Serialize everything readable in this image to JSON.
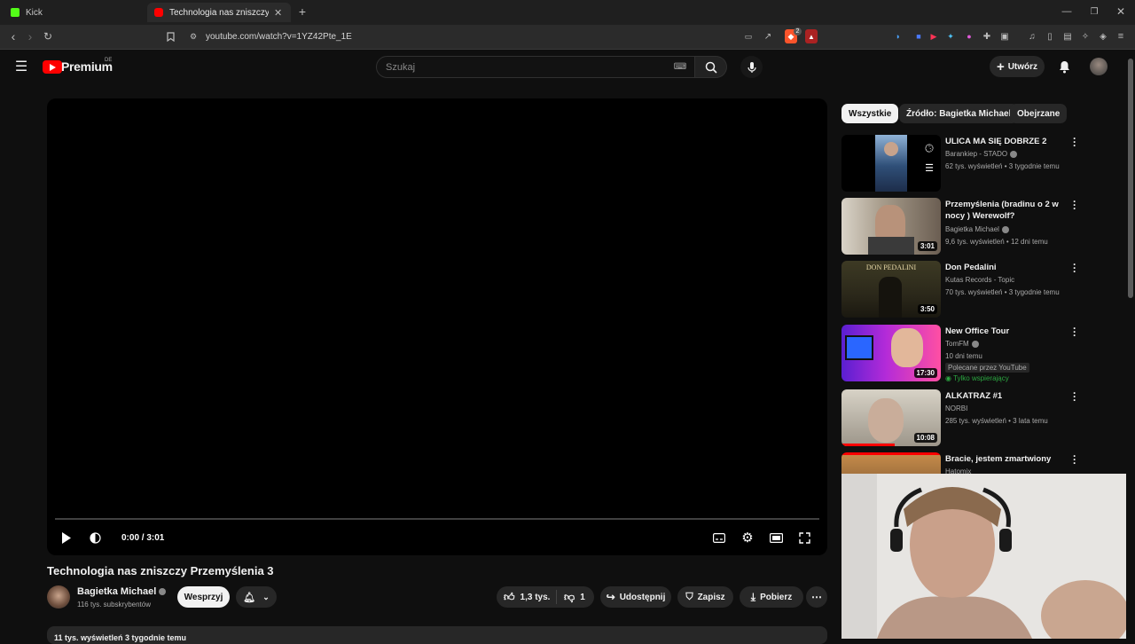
{
  "browser": {
    "tabs": [
      {
        "label": "Kick",
        "active": false
      },
      {
        "label": "Technologia nas zniszczy Przemy",
        "active": true
      }
    ],
    "url": "youtube.com/watch?v=1YZ42Pte_1E",
    "shield_badge": "2"
  },
  "masthead": {
    "logo_text": "Premium",
    "region": "DE",
    "search_placeholder": "Szukaj",
    "create_label": "Utwórz"
  },
  "player": {
    "time": "0:00 / 3:01",
    "progress": 0
  },
  "video": {
    "title": "Technologia nas zniszczy Przemyślenia 3",
    "channel": "Bagietka Michael",
    "subscribers": "116 tys. subskrybentów",
    "support_label": "Wesprzyj",
    "likes": "1,3 tys.",
    "dislikes": "1",
    "share_label": "Udostępnij",
    "save_label": "Zapisz",
    "download_label": "Pobierz",
    "stats": "11 tys. wyświetleń 3 tygodnie temu"
  },
  "chips": [
    "Wszystkie",
    "Źródło: Bagietka Michael",
    "Obejrzane"
  ],
  "recommendations": [
    {
      "title": "ULICA MA SIĘ DOBRZE 2",
      "channel": "Barankiep - STADO",
      "verified": true,
      "meta": "62 tys. wyświetleń • 3 tygodnie temu",
      "duration": ""
    },
    {
      "title": "Przemyślenia (bradinu o 2 w nocy ) Werewolf?",
      "channel": "Bagietka Michael",
      "verified": true,
      "meta": "9,6 tys. wyświetleń • 12 dni temu",
      "duration": "3:01"
    },
    {
      "title": "Don Pedalini",
      "channel": "Kutas Records - Topic",
      "verified": false,
      "meta": "70 tys. wyświetleń • 3 tygodnie temu",
      "duration": "3:50",
      "thumb_text": "DON PEDALINI"
    },
    {
      "title": "New Office Tour",
      "channel": "TomFM",
      "verified": true,
      "meta": "10 dni temu",
      "duration": "17:30",
      "badge": "Polecane przez YouTube",
      "members": "Tylko wspierający"
    },
    {
      "title": "ALKATRAZ #1",
      "channel": "NORBI",
      "verified": false,
      "meta": "285 tys. wyświetleń • 3 lata temu",
      "duration": "10:08"
    },
    {
      "title": "Bracie, jestem zmartwiony",
      "channel": "Hatomix",
      "verified": false,
      "meta": "",
      "duration": ""
    }
  ],
  "colors": {
    "brand_red": "#ff0000",
    "bg": "#0f0f0f",
    "chip": "#272727",
    "members_green": "#2ba640"
  }
}
